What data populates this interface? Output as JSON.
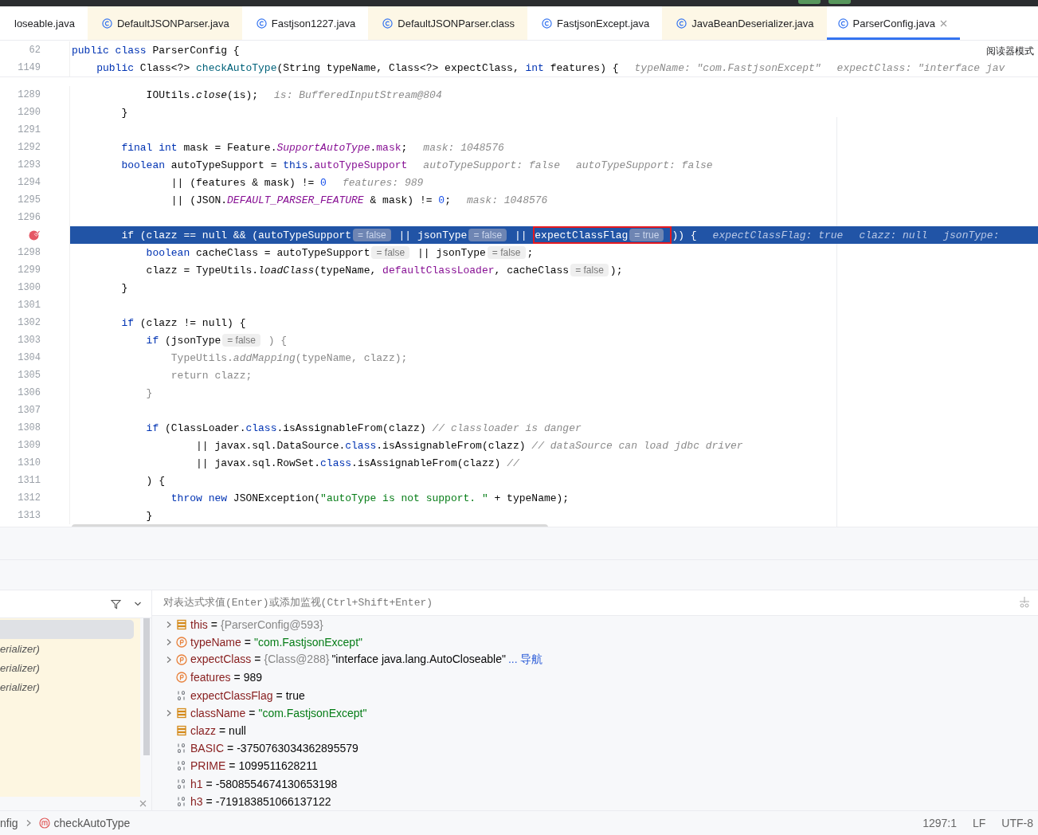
{
  "tabs": [
    {
      "label": "loseable.java",
      "icon": false,
      "color": "#ffffff",
      "selected": false,
      "closable": false
    },
    {
      "label": "DefaultJSONParser.java",
      "icon": true,
      "color": "#fdf7e6",
      "selected": false,
      "closable": false
    },
    {
      "label": "Fastjson1227.java",
      "icon": true,
      "color": "#ffffff",
      "selected": false,
      "closable": false
    },
    {
      "label": "DefaultJSONParser.class",
      "icon": true,
      "color": "#fdf7e6",
      "selected": false,
      "closable": false
    },
    {
      "label": "FastjsonExcept.java",
      "icon": true,
      "color": "#ffffff",
      "selected": false,
      "closable": false
    },
    {
      "label": "JavaBeanDeserializer.java",
      "icon": true,
      "color": "#fdf7e6",
      "selected": false,
      "closable": false
    },
    {
      "label": "ParserConfig.java",
      "icon": true,
      "color": "#ffffff",
      "selected": true,
      "closable": true
    }
  ],
  "reader_mode": "阅读器模式",
  "sticky_lines": [
    {
      "n": "62",
      "tokens": [
        {
          "kind": "kw",
          "t": "public"
        },
        {
          "kind": "kw",
          "t": " class"
        },
        {
          "kind": "plain",
          "t": " ParserConfig {"
        }
      ]
    },
    {
      "n": "1149",
      "tokens": [
        {
          "kind": "kw",
          "t": "    public"
        },
        {
          "kind": "plain",
          "t": " Class<?> "
        },
        {
          "kind": "method",
          "t": "checkAutoType"
        },
        {
          "kind": "plain",
          "t": "(String typeName, Class<?> expectClass, "
        },
        {
          "kind": "kw",
          "t": "int"
        },
        {
          "kind": "plain",
          "t": " features) {"
        },
        {
          "kind": "debug",
          "t": "typeName: \"com.FastjsonExcept\""
        },
        {
          "kind": "debug",
          "t": "expectClass: \"interface jav"
        }
      ]
    }
  ],
  "lines": [
    {
      "n": "1289",
      "breakpoint": false,
      "highlighted": false,
      "tokens": [
        {
          "kind": "plain",
          "t": "            IOUtils."
        },
        {
          "kind": "italic",
          "t": "close"
        },
        {
          "kind": "plain",
          "t": "(is);"
        },
        {
          "kind": "debug",
          "t": "is: BufferedInputStream@804"
        }
      ]
    },
    {
      "n": "1290",
      "breakpoint": false,
      "highlighted": false,
      "tokens": [
        {
          "kind": "plain",
          "t": "        }"
        }
      ]
    },
    {
      "n": "1291",
      "breakpoint": false,
      "highlighted": false
    },
    {
      "n": "1292",
      "breakpoint": false,
      "highlighted": false,
      "tokens": [
        {
          "kind": "kw",
          "t": "        final"
        },
        {
          "kind": "kw",
          "t": " int"
        },
        {
          "kind": "plain",
          "t": " mask = Feature."
        },
        {
          "kind": "static",
          "t": "SupportAutoType"
        },
        {
          "kind": "plain",
          "t": "."
        },
        {
          "kind": "field",
          "t": "mask"
        },
        {
          "kind": "plain",
          "t": ";"
        },
        {
          "kind": "debug",
          "t": "mask: 1048576"
        }
      ]
    },
    {
      "n": "1293",
      "breakpoint": false,
      "highlighted": false,
      "tokens": [
        {
          "kind": "kw",
          "t": "        boolean"
        },
        {
          "kind": "plain",
          "t": " autoTypeSupport = "
        },
        {
          "kind": "kw",
          "t": "this"
        },
        {
          "kind": "plain",
          "t": "."
        },
        {
          "kind": "field",
          "t": "autoTypeSupport"
        },
        {
          "kind": "debug",
          "t": "autoTypeSupport: false"
        },
        {
          "kind": "debug",
          "t": "autoTypeSupport: false"
        }
      ]
    },
    {
      "n": "1294",
      "breakpoint": false,
      "highlighted": false,
      "tokens": [
        {
          "kind": "plain",
          "t": "                || (features & mask) != "
        },
        {
          "kind": "num",
          "t": "0"
        },
        {
          "kind": "debug",
          "t": "features: 989"
        }
      ]
    },
    {
      "n": "1295",
      "breakpoint": false,
      "highlighted": false,
      "tokens": [
        {
          "kind": "plain",
          "t": "                || (JSON."
        },
        {
          "kind": "static",
          "t": "DEFAULT_PARSER_FEATURE"
        },
        {
          "kind": "plain",
          "t": " & mask) != "
        },
        {
          "kind": "num",
          "t": "0"
        },
        {
          "kind": "plain",
          "t": ";"
        },
        {
          "kind": "debug",
          "t": "mask: 1048576"
        }
      ]
    },
    {
      "n": "1296",
      "breakpoint": false,
      "highlighted": false
    },
    {
      "breakpoint": true,
      "highlighted": true,
      "tokens": [
        {
          "kind": "kw",
          "t": "        if"
        },
        {
          "kind": "plain",
          "t": " (clazz == null && (autoTypeSupport"
        },
        {
          "kind": "hint",
          "t": "= false"
        },
        {
          "kind": "plain",
          "t": " || jsonType"
        },
        {
          "kind": "hint",
          "t": "= false"
        },
        {
          "kind": "plain",
          "t": " || "
        },
        {
          "kind": "boxed",
          "tokens": [
            {
              "kind": "plain",
              "t": "expectClassFlag"
            },
            {
              "kind": "hint",
              "t": "= true"
            }
          ]
        },
        {
          "kind": "plain",
          "t": ")) {"
        },
        {
          "kind": "debug",
          "t": "expectClassFlag: true"
        },
        {
          "kind": "debug",
          "t": "clazz: null"
        },
        {
          "kind": "debug",
          "t": "jsonType:"
        }
      ]
    },
    {
      "n": "1298",
      "breakpoint": false,
      "highlighted": false,
      "tokens": [
        {
          "kind": "kw",
          "t": "            boolean"
        },
        {
          "kind": "plain",
          "t": " cacheClass = autoTypeSupport"
        },
        {
          "kind": "hint",
          "t": "= false"
        },
        {
          "kind": "plain",
          "t": " || jsonType"
        },
        {
          "kind": "hint",
          "t": "= false"
        },
        {
          "kind": "plain",
          "t": ";"
        }
      ]
    },
    {
      "n": "1299",
      "breakpoint": false,
      "highlighted": false,
      "tokens": [
        {
          "kind": "plain",
          "t": "            clazz = TypeUtils."
        },
        {
          "kind": "italic",
          "t": "loadClass"
        },
        {
          "kind": "plain",
          "t": "(typeName, "
        },
        {
          "kind": "field",
          "t": "defaultClassLoader"
        },
        {
          "kind": "plain",
          "t": ", cacheClass"
        },
        {
          "kind": "hint",
          "t": "= false"
        },
        {
          "kind": "plain",
          "t": ");"
        }
      ]
    },
    {
      "n": "1300",
      "breakpoint": false,
      "highlighted": false,
      "tokens": [
        {
          "kind": "plain",
          "t": "        }"
        }
      ]
    },
    {
      "n": "1301",
      "breakpoint": false,
      "highlighted": false
    },
    {
      "n": "1302",
      "breakpoint": false,
      "highlighted": false,
      "tokens": [
        {
          "kind": "kw",
          "t": "        if"
        },
        {
          "kind": "plain",
          "t": " (clazz != null) {"
        }
      ]
    },
    {
      "n": "1303",
      "breakpoint": false,
      "highlighted": false,
      "tokens": [
        {
          "kind": "kw",
          "t": "            if"
        },
        {
          "kind": "plain",
          "t": " (jsonType"
        },
        {
          "kind": "hint",
          "t": "= false"
        },
        {
          "kind": "faded",
          "t": " ) {"
        }
      ]
    },
    {
      "n": "1304",
      "breakpoint": false,
      "highlighted": false,
      "tokens": [
        {
          "kind": "faded",
          "t": "                TypeUtils."
        },
        {
          "kind": "faded-italic",
          "t": "addMapping"
        },
        {
          "kind": "faded",
          "t": "(typeName, clazz);"
        }
      ]
    },
    {
      "n": "1305",
      "breakpoint": false,
      "highlighted": false,
      "tokens": [
        {
          "kind": "faded",
          "t": "                return clazz;"
        }
      ]
    },
    {
      "n": "1306",
      "breakpoint": false,
      "highlighted": false,
      "tokens": [
        {
          "kind": "faded",
          "t": "            }"
        }
      ]
    },
    {
      "n": "1307",
      "breakpoint": false,
      "highlighted": false
    },
    {
      "n": "1308",
      "breakpoint": false,
      "highlighted": false,
      "tokens": [
        {
          "kind": "kw",
          "t": "            if"
        },
        {
          "kind": "plain",
          "t": " (ClassLoader."
        },
        {
          "kind": "kw",
          "t": "class"
        },
        {
          "kind": "plain",
          "t": ".isAssignableFrom(clazz) "
        },
        {
          "kind": "comment",
          "t": "// classloader is danger"
        }
      ]
    },
    {
      "n": "1309",
      "breakpoint": false,
      "highlighted": false,
      "tokens": [
        {
          "kind": "plain",
          "t": "                    || javax.sql.DataSource."
        },
        {
          "kind": "kw",
          "t": "class"
        },
        {
          "kind": "plain",
          "t": ".isAssignableFrom(clazz) "
        },
        {
          "kind": "comment",
          "t": "// dataSource can load jdbc driver"
        }
      ]
    },
    {
      "n": "1310",
      "breakpoint": false,
      "highlighted": false,
      "tokens": [
        {
          "kind": "plain",
          "t": "                    || javax.sql.RowSet."
        },
        {
          "kind": "kw",
          "t": "class"
        },
        {
          "kind": "plain",
          "t": ".isAssignableFrom(clazz) "
        },
        {
          "kind": "comment",
          "t": "//"
        }
      ]
    },
    {
      "n": "1311",
      "breakpoint": false,
      "highlighted": false,
      "tokens": [
        {
          "kind": "plain",
          "t": "            ) {"
        }
      ]
    },
    {
      "n": "1312",
      "breakpoint": false,
      "highlighted": false,
      "tokens": [
        {
          "kind": "kw",
          "t": "                throw"
        },
        {
          "kind": "kw",
          "t": " new"
        },
        {
          "kind": "plain",
          "t": " JSONException("
        },
        {
          "kind": "str",
          "t": "\"autoType is not support. \""
        },
        {
          "kind": "plain",
          "t": " + typeName);"
        }
      ]
    },
    {
      "n": "1313",
      "breakpoint": false,
      "highlighted": false,
      "tokens": [
        {
          "kind": "plain",
          "t": "            }"
        }
      ]
    }
  ],
  "frames": [
    {
      "selected": true
    },
    {
      "label": "erializer)",
      "selected": false
    },
    {
      "label": "erializer)",
      "selected": false
    },
    {
      "label": "erializer)",
      "selected": false
    }
  ],
  "evaluate": {
    "placeholder": "对表达式求值(Enter)或添加监视(Ctrl+Shift+Enter)"
  },
  "variables": [
    {
      "expandable": true,
      "kind": "field",
      "name": "this",
      "operator": "=",
      "value": [
        {
          "kind": "ref",
          "t": "{ParserConfig@593}"
        }
      ]
    },
    {
      "expandable": true,
      "kind": "param",
      "name": "typeName",
      "operator": "=",
      "value": [
        {
          "kind": "str",
          "t": "\"com.FastjsonExcept\""
        }
      ]
    },
    {
      "expandable": true,
      "kind": "param",
      "name": "expectClass",
      "operator": "=",
      "value": [
        {
          "kind": "ref",
          "t": "{Class@288}"
        },
        {
          "kind": "plain",
          "t": "\"interface java.lang.AutoCloseable\""
        },
        {
          "kind": "link",
          "t": "... 导航"
        }
      ]
    },
    {
      "expandable": false,
      "kind": "param",
      "name": "features",
      "operator": "=",
      "value": [
        {
          "kind": "plain",
          "t": "989"
        }
      ]
    },
    {
      "expandable": false,
      "kind": "primitive",
      "name": "expectClassFlag",
      "operator": "=",
      "value": [
        {
          "kind": "plain",
          "t": "true"
        }
      ]
    },
    {
      "expandable": true,
      "kind": "field",
      "name": "className",
      "operator": "=",
      "value": [
        {
          "kind": "str",
          "t": "\"com.FastjsonExcept\""
        }
      ]
    },
    {
      "expandable": false,
      "kind": "field",
      "name": "clazz",
      "operator": "=",
      "value": [
        {
          "kind": "plain",
          "t": "null"
        }
      ]
    },
    {
      "expandable": false,
      "kind": "primitive",
      "name": "BASIC",
      "operator": "=",
      "value": [
        {
          "kind": "plain",
          "t": "-3750763034362895579"
        }
      ]
    },
    {
      "expandable": false,
      "kind": "primitive",
      "name": "PRIME",
      "operator": "=",
      "value": [
        {
          "kind": "plain",
          "t": "1099511628211"
        }
      ]
    },
    {
      "expandable": false,
      "kind": "primitive",
      "name": "h1",
      "operator": "=",
      "value": [
        {
          "kind": "plain",
          "t": "-5808554674130653198"
        }
      ]
    },
    {
      "expandable": false,
      "kind": "primitive",
      "name": "h3",
      "operator": "=",
      "value": [
        {
          "kind": "plain",
          "t": "-719183851066137122"
        }
      ]
    }
  ],
  "status_bar": {
    "breadcrumb": [
      "nfig",
      "checkAutoType"
    ],
    "position": "1297:1",
    "line_ending": "LF",
    "encoding": "UTF-8"
  }
}
